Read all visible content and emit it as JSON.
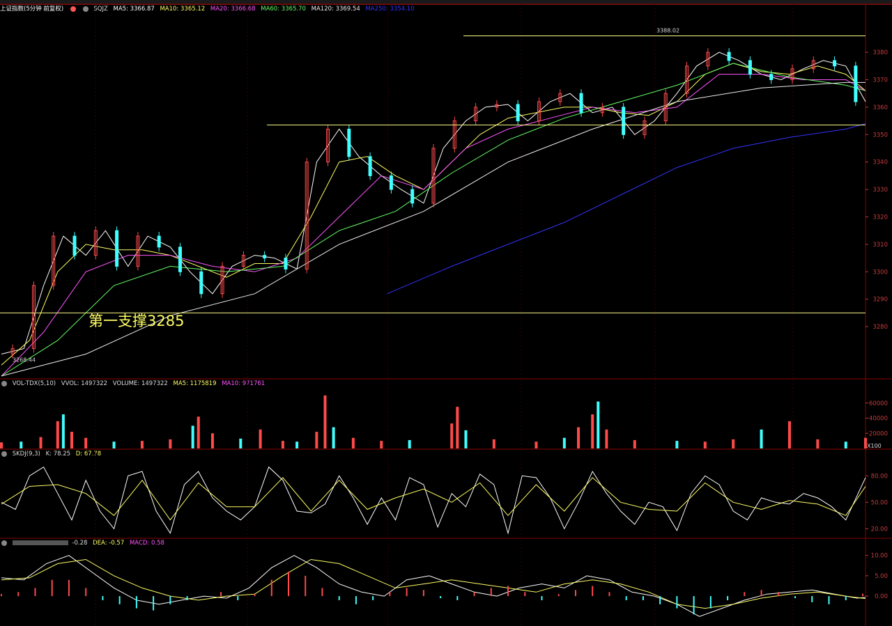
{
  "header": {
    "title": "上证指数(5分钟 前复权)",
    "indicator": "SQJZ",
    "ma5": "MA5: 3366.87",
    "ma10": "MA10: 3365.12",
    "ma20": "MA20: 3366.68",
    "ma60": "MA60: 3365.70",
    "ma120": "MA120: 3369.54",
    "ma250": "MA250: 3354.10"
  },
  "vol_header": {
    "name": "VOL-TDX(5,10)",
    "vvol": "VVOL: 1497322",
    "volume": "VOLUME: 1497322",
    "ma5": "MA5: 1175819",
    "ma10": "MA10: 971761"
  },
  "skdj_header": {
    "name": "SKDJ(9,3)",
    "k": "K: 78.25",
    "d": "D: 67.78"
  },
  "macd_header": {
    "dif": "-0.28",
    "dea": "DEA: -0.57",
    "macd": "MACD: 0.58"
  },
  "annotations": {
    "high": "3388.02",
    "low": "3268.44",
    "support": "第一支撑3285",
    "vol_unit": "X100"
  },
  "colors": {
    "up": "#ff4a4a",
    "down": "#40ffff",
    "ma5": "#ffffff",
    "ma10": "#ffff66",
    "ma20": "#ff55ff",
    "ma60": "#66ff66",
    "ma120": "#eeeeee",
    "ma250": "#3333ff",
    "grid": "#8b0000",
    "support_line": "#ffff88"
  },
  "chart_data": [
    {
      "type": "line",
      "title": "上证指数(5分钟 前复权)",
      "ylim": [
        3262,
        3395
      ],
      "yticks": [
        3280,
        3290,
        3300,
        3310,
        3320,
        3330,
        3340,
        3350,
        3360,
        3370,
        3380
      ],
      "support_level": 3285,
      "resistance_level": 3353.5,
      "upper_level": 3386,
      "series": [
        {
          "name": "MA5",
          "x": [
            0,
            8,
            15,
            22,
            30,
            37,
            45,
            52,
            60,
            67,
            75,
            82,
            90,
            97,
            105,
            112,
            120,
            127,
            135,
            142,
            150,
            157,
            165,
            172,
            180,
            187,
            195,
            202,
            210,
            217,
            225,
            232,
            240,
            247,
            255,
            262,
            270,
            277,
            285,
            292,
            300,
            307
          ],
          "values": [
            3270,
            3272,
            3295,
            3313,
            3306,
            3315,
            3302,
            3313,
            3309,
            3300,
            3292,
            3302,
            3306,
            3305,
            3301,
            3340,
            3352,
            3342,
            3335,
            3330,
            3325,
            3345,
            3355,
            3360,
            3361,
            3355,
            3362,
            3365,
            3358,
            3360,
            3350,
            3355,
            3365,
            3375,
            3380,
            3377,
            3372,
            3370,
            3374,
            3377,
            3375,
            3362
          ]
        },
        {
          "name": "MA10",
          "x": [
            0,
            10,
            20,
            30,
            40,
            50,
            60,
            70,
            80,
            90,
            100,
            110,
            120,
            130,
            140,
            150,
            160,
            170,
            180,
            190,
            200,
            210,
            220,
            230,
            240,
            250,
            260,
            270,
            280,
            290,
            300,
            307
          ],
          "values": [
            3266,
            3275,
            3300,
            3310,
            3308,
            3308,
            3306,
            3302,
            3298,
            3303,
            3303,
            3320,
            3340,
            3342,
            3335,
            3330,
            3340,
            3350,
            3356,
            3358,
            3360,
            3360,
            3358,
            3357,
            3362,
            3372,
            3376,
            3373,
            3372,
            3375,
            3372,
            3366
          ]
        },
        {
          "name": "MA20",
          "x": [
            0,
            15,
            30,
            45,
            60,
            75,
            90,
            105,
            120,
            135,
            150,
            165,
            180,
            195,
            210,
            225,
            240,
            255,
            270,
            285,
            300,
            307
          ],
          "values": [
            3262,
            3278,
            3300,
            3306,
            3306,
            3302,
            3300,
            3305,
            3320,
            3335,
            3330,
            3345,
            3352,
            3356,
            3360,
            3358,
            3360,
            3372,
            3372,
            3370,
            3370,
            3366
          ]
        },
        {
          "name": "MA60",
          "x": [
            0,
            20,
            40,
            60,
            80,
            100,
            120,
            140,
            160,
            180,
            200,
            220,
            240,
            260,
            280,
            300,
            307
          ],
          "values": [
            3262,
            3275,
            3295,
            3302,
            3300,
            3302,
            3315,
            3322,
            3336,
            3348,
            3356,
            3362,
            3368,
            3376,
            3371,
            3368,
            3366
          ]
        },
        {
          "name": "MA120",
          "x": [
            0,
            30,
            60,
            90,
            120,
            150,
            180,
            210,
            240,
            270,
            300,
            307
          ],
          "values": [
            3262,
            3270,
            3284,
            3292,
            3310,
            3322,
            3340,
            3352,
            3362,
            3367,
            3369,
            3369
          ]
        },
        {
          "name": "MA250",
          "x": [
            137,
            160,
            180,
            200,
            220,
            240,
            260,
            280,
            300,
            307
          ],
          "values": [
            3292,
            3302,
            3310,
            3318,
            3328,
            3338,
            3345,
            3349,
            3352,
            3354
          ]
        }
      ]
    },
    {
      "type": "bar",
      "title": "VOL-TDX(5,10)",
      "ylim": [
        0,
        80000
      ],
      "yticks": [
        20000,
        40000,
        60000
      ],
      "series": [
        {
          "name": "VOLUME",
          "x": [
            0,
            7,
            14,
            20,
            22,
            25,
            30,
            40,
            50,
            60,
            68,
            70,
            75,
            85,
            92,
            100,
            105,
            112,
            115,
            118,
            125,
            135,
            145,
            160,
            162,
            165,
            175,
            190,
            200,
            205,
            210,
            212,
            215,
            225,
            240,
            250,
            260,
            270,
            280,
            290,
            300,
            307
          ],
          "values": [
            8000,
            9000,
            15000,
            36000,
            45000,
            22000,
            14000,
            9000,
            10000,
            12000,
            30000,
            42000,
            20000,
            13000,
            25000,
            10000,
            9000,
            22000,
            70000,
            28000,
            14000,
            10000,
            11000,
            33000,
            55000,
            24000,
            12000,
            9000,
            14000,
            28000,
            45000,
            62000,
            25000,
            11000,
            10000,
            9000,
            12000,
            25000,
            36000,
            12000,
            9000,
            14000
          ]
        }
      ]
    },
    {
      "type": "line",
      "title": "SKDJ(9,3)",
      "ylim": [
        10,
        100
      ],
      "yticks": [
        20,
        50,
        80
      ],
      "series": [
        {
          "name": "K",
          "x": [
            0,
            5,
            10,
            15,
            20,
            25,
            30,
            35,
            40,
            45,
            50,
            55,
            60,
            65,
            70,
            75,
            80,
            85,
            90,
            95,
            100,
            105,
            110,
            115,
            120,
            125,
            130,
            135,
            140,
            145,
            150,
            155,
            160,
            165,
            170,
            175,
            180,
            185,
            190,
            195,
            200,
            205,
            210,
            215,
            220,
            225,
            230,
            235,
            240,
            245,
            250,
            255,
            260,
            265,
            270,
            275,
            280,
            285,
            290,
            295,
            300,
            307
          ],
          "values": [
            50,
            42,
            80,
            90,
            60,
            30,
            75,
            40,
            20,
            80,
            85,
            40,
            15,
            70,
            85,
            55,
            40,
            30,
            45,
            90,
            75,
            40,
            38,
            48,
            80,
            55,
            25,
            55,
            30,
            78,
            70,
            22,
            60,
            45,
            82,
            70,
            15,
            80,
            78,
            55,
            20,
            50,
            85,
            60,
            40,
            25,
            50,
            45,
            18,
            60,
            80,
            70,
            40,
            30,
            55,
            50,
            48,
            60,
            55,
            45,
            30,
            78
          ]
        },
        {
          "name": "D",
          "x": [
            0,
            10,
            20,
            30,
            40,
            50,
            60,
            70,
            80,
            90,
            100,
            110,
            120,
            130,
            140,
            150,
            160,
            170,
            180,
            190,
            200,
            210,
            220,
            230,
            240,
            250,
            260,
            270,
            280,
            290,
            300,
            307
          ],
          "values": [
            48,
            68,
            70,
            60,
            35,
            75,
            30,
            72,
            45,
            45,
            78,
            40,
            75,
            42,
            55,
            65,
            50,
            72,
            35,
            70,
            40,
            78,
            50,
            42,
            40,
            72,
            50,
            42,
            52,
            48,
            35,
            68
          ]
        }
      ]
    },
    {
      "type": "line",
      "title": "MACD",
      "ylim": [
        -7,
        12
      ],
      "yticks": [
        0,
        5,
        10
      ],
      "series": [
        {
          "name": "DIF",
          "x": [
            0,
            8,
            16,
            24,
            32,
            40,
            48,
            56,
            64,
            72,
            80,
            88,
            96,
            104,
            112,
            120,
            128,
            136,
            144,
            152,
            160,
            168,
            176,
            184,
            192,
            200,
            208,
            216,
            224,
            232,
            240,
            248,
            256,
            264,
            272,
            280,
            288,
            296,
            304,
            307
          ],
          "values": [
            4.5,
            4,
            8,
            10,
            6,
            2,
            -1,
            -2,
            -1,
            0,
            -0.5,
            2,
            7,
            10,
            7,
            3,
            1,
            0,
            4,
            5,
            3,
            1,
            0,
            2,
            3,
            2,
            5,
            4,
            1,
            0,
            -2,
            -5,
            -3,
            -1,
            0.5,
            1,
            1.5,
            0.5,
            -0.5,
            -0.3
          ]
        },
        {
          "name": "DEA",
          "x": [
            0,
            10,
            20,
            30,
            40,
            50,
            60,
            70,
            80,
            90,
            100,
            110,
            120,
            130,
            140,
            150,
            160,
            170,
            180,
            190,
            200,
            210,
            220,
            230,
            240,
            250,
            260,
            270,
            280,
            290,
            300,
            307
          ],
          "values": [
            4,
            4.5,
            8,
            9,
            5,
            2,
            0,
            -1,
            0,
            0.5,
            5,
            9,
            8,
            5,
            2,
            3,
            4,
            3,
            2,
            1,
            3,
            4,
            3,
            1,
            -2,
            -3,
            -2,
            -0.5,
            0.5,
            1,
            0,
            -0.6
          ]
        },
        {
          "name": "MACD",
          "x": [
            0,
            6,
            12,
            18,
            24,
            30,
            36,
            42,
            48,
            54,
            60,
            66,
            72,
            78,
            84,
            90,
            96,
            102,
            108,
            114,
            120,
            126,
            132,
            138,
            144,
            150,
            156,
            162,
            168,
            174,
            180,
            186,
            192,
            198,
            204,
            210,
            216,
            222,
            228,
            234,
            240,
            246,
            252,
            258,
            264,
            270,
            276,
            282,
            288,
            294,
            300,
            306
          ],
          "values": [
            0.5,
            1,
            2,
            4,
            4,
            2,
            -1,
            -2,
            -3,
            -3.5,
            -2,
            -1,
            0,
            1,
            -1,
            0.5,
            4,
            6,
            5,
            2,
            -1,
            -2,
            -1,
            1,
            2,
            1.5,
            -0.5,
            -1,
            1,
            2,
            2.5,
            1,
            -1,
            0.5,
            1.5,
            2.5,
            1,
            -1,
            -1,
            -2,
            -3,
            -4.5,
            -3,
            -1,
            1,
            1.5,
            1,
            -0.5,
            -1.5,
            -2,
            -1,
            0.6
          ]
        }
      ]
    }
  ]
}
